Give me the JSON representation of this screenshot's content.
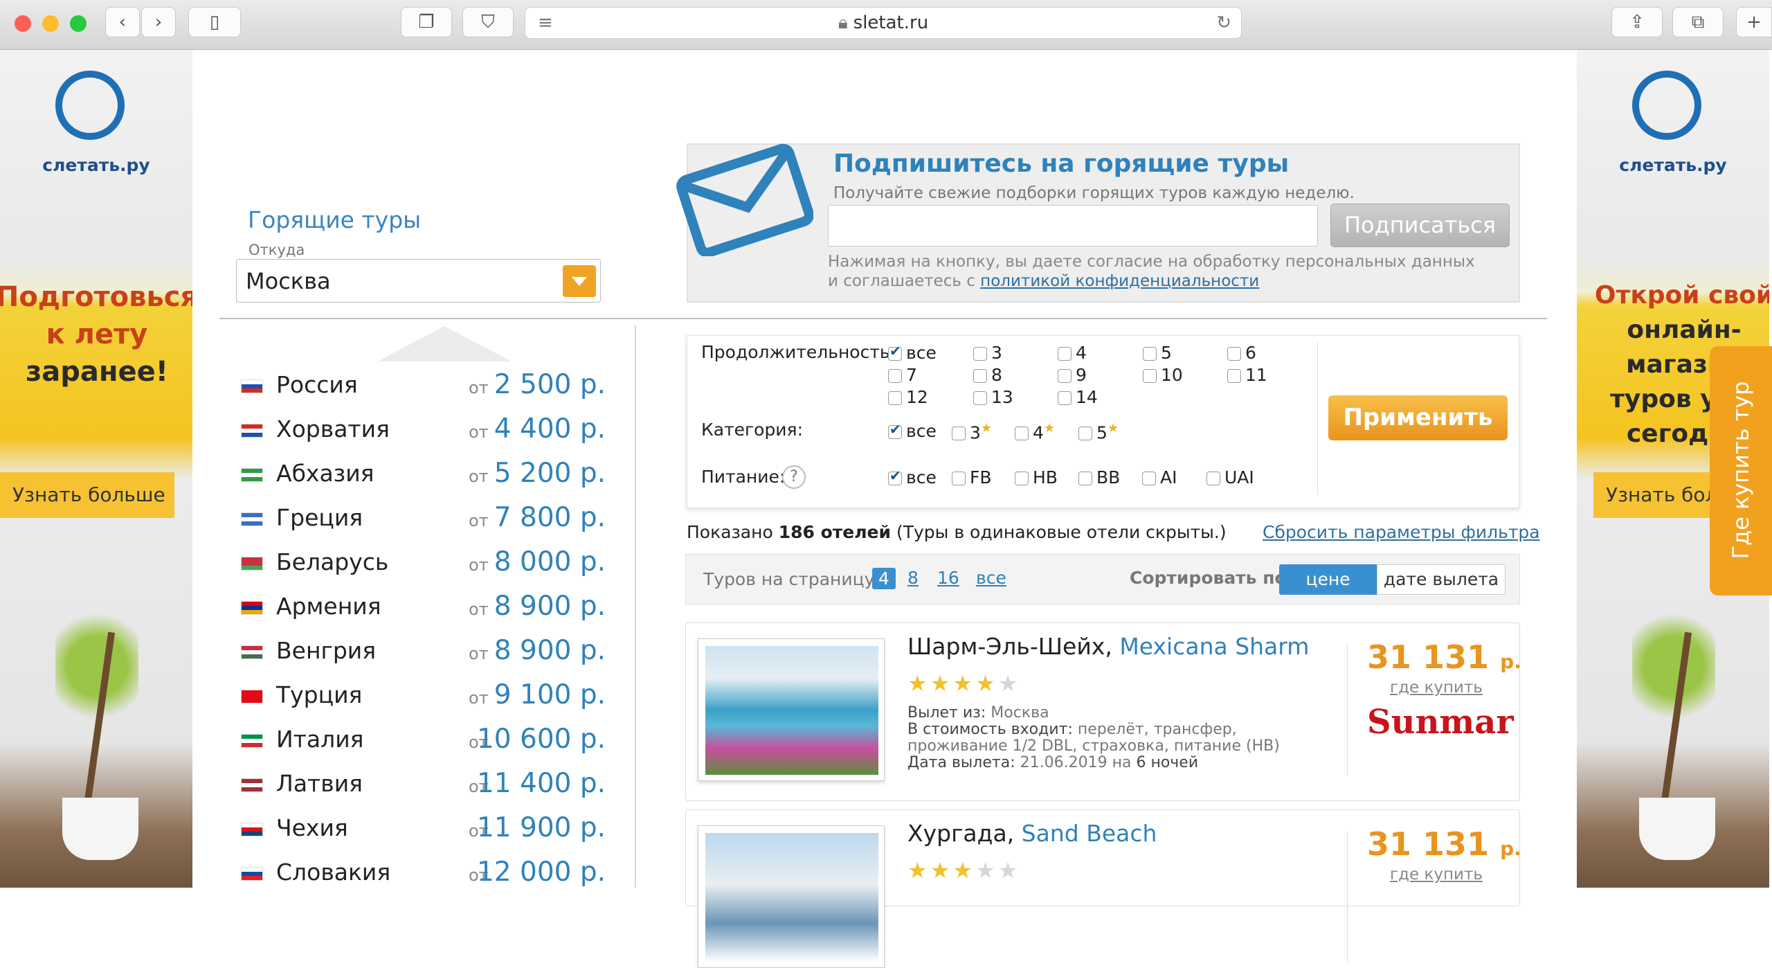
{
  "browser": {
    "url": "sletat.ru"
  },
  "colors": {
    "accent_blue": "#2f82ba",
    "orange": "#f1a424",
    "price_orange": "#e89520"
  },
  "left_banner": {
    "logo": "слетать.ру",
    "promo_line1": "Подготовься",
    "promo_line2": "к лету",
    "promo_line3": "заранее!",
    "button": "Узнать больше"
  },
  "right_banner": {
    "logo": "слетать.ру",
    "promo_line1": "Открой свой",
    "promo_line2": "онлайн-магазин",
    "promo_line3": "туров уже",
    "promo_line4": "сегодня",
    "button": "Узнать больше",
    "side_tab": "Где купить тур"
  },
  "hot_tours": {
    "title": "Горящие туры",
    "from_label": "Откуда",
    "from_value": "Москва",
    "price_prefix": "от",
    "countries": [
      {
        "name": "Россия",
        "price": "2 500 р.",
        "flag": [
          "#ffffff",
          "#1f4fb4",
          "#d52b1e"
        ]
      },
      {
        "name": "Хорватия",
        "price": "4 400 р.",
        "flag": [
          "#d52b1e",
          "#ffffff",
          "#1f4fb4"
        ]
      },
      {
        "name": "Абхазия",
        "price": "5 200 р.",
        "flag": [
          "#2f9a4a",
          "#ffffff",
          "#2f9a4a"
        ]
      },
      {
        "name": "Греция",
        "price": "7 800 р.",
        "flag": [
          "#3a6fc2",
          "#ffffff",
          "#3a6fc2"
        ]
      },
      {
        "name": "Беларусь",
        "price": "8 000 р.",
        "flag": [
          "#c8313e",
          "#c8313e",
          "#4aa657"
        ]
      },
      {
        "name": "Армения",
        "price": "8 900 р.",
        "flag": [
          "#d90012",
          "#0033a0",
          "#f2a800"
        ]
      },
      {
        "name": "Венгрия",
        "price": "8 900 р.",
        "flag": [
          "#cd2a3e",
          "#ffffff",
          "#436f4d"
        ]
      },
      {
        "name": "Турция",
        "price": "9 100 р.",
        "flag": [
          "#e30a17",
          "#e30a17",
          "#e30a17"
        ]
      },
      {
        "name": "Италия",
        "price": "10 600 р.",
        "flag": [
          "#009246",
          "#ffffff",
          "#ce2b37"
        ]
      },
      {
        "name": "Латвия",
        "price": "11 400 р.",
        "flag": [
          "#9e3039",
          "#ffffff",
          "#9e3039"
        ]
      },
      {
        "name": "Чехия",
        "price": "11 900 р.",
        "flag": [
          "#ffffff",
          "#d7141a",
          "#11457e"
        ]
      },
      {
        "name": "Словакия",
        "price": "12 000 р.",
        "flag": [
          "#ffffff",
          "#0b4ea2",
          "#ee1c25"
        ]
      }
    ]
  },
  "subscribe": {
    "title": "Подпишитесь на горящие туры",
    "subtitle": "Получайте свежие подборки горящих туров каждую неделю.",
    "email_placeholder": "",
    "button": "Подписаться",
    "note": "Нажимая на кнопку, вы даете согласие на обработку персональных данных и соглашаетесь с",
    "policy_link": "политикой конфиденциальности"
  },
  "filter": {
    "duration_label": "Продолжительность:",
    "duration_options": [
      {
        "label": "все",
        "checked": true
      },
      {
        "label": "3",
        "checked": false
      },
      {
        "label": "4",
        "checked": false
      },
      {
        "label": "5",
        "checked": false
      },
      {
        "label": "6",
        "checked": false
      },
      {
        "label": "7",
        "checked": false
      },
      {
        "label": "8",
        "checked": false
      },
      {
        "label": "9",
        "checked": false
      },
      {
        "label": "10",
        "checked": false
      },
      {
        "label": "11",
        "checked": false
      },
      {
        "label": "12",
        "checked": false
      },
      {
        "label": "13",
        "checked": false
      },
      {
        "label": "14",
        "checked": false
      }
    ],
    "category_label": "Категория:",
    "category_options": [
      {
        "label": "все",
        "checked": true
      },
      {
        "label": "3",
        "checked": false
      },
      {
        "label": "4",
        "checked": false
      },
      {
        "label": "5",
        "checked": false
      }
    ],
    "food_label": "Питание:",
    "food_help": "?",
    "food_options": [
      {
        "label": "все",
        "checked": true
      },
      {
        "label": "FB",
        "checked": false
      },
      {
        "label": "HB",
        "checked": false
      },
      {
        "label": "BB",
        "checked": false
      },
      {
        "label": "AI",
        "checked": false
      },
      {
        "label": "UAI",
        "checked": false
      }
    ],
    "apply_button": "Применить"
  },
  "results": {
    "shown_prefix": "Показано",
    "shown_count": "186 отелей",
    "shown_suffix": "(Туры в одинаковые отели скрыты.)",
    "reset_link": "Сбросить параметры фильтра",
    "per_page_label": "Туров на страницу:",
    "per_page_options": [
      "4",
      "8",
      "16",
      "все"
    ],
    "per_page_active": "4",
    "sort_label": "Сортировать по:",
    "sort_options": [
      "цене",
      "дате вылета"
    ],
    "sort_active": "цене"
  },
  "hotels": [
    {
      "city": "Шарм-Эль-Шейх,",
      "name": "Mexicana Sharm Resort",
      "stars": 4,
      "depart_label": "Вылет из:",
      "depart_city": "Москва",
      "includes_label": "В стоимость входит:",
      "includes": "перелёт, трансфер, проживание 1/2 DBL, страховка, питание (HB)",
      "date_label": "Дата вылета:",
      "date": "21.06.2019",
      "date_on": "на",
      "nights": "6 ночей",
      "price": "31 131",
      "currency": "р.",
      "where_buy": "где купить",
      "operator": "Sunmar"
    },
    {
      "city": "Хургада,",
      "name": "Sand Beach",
      "stars": 3,
      "price": "31 131",
      "currency": "р.",
      "where_buy": "где купить"
    }
  ]
}
